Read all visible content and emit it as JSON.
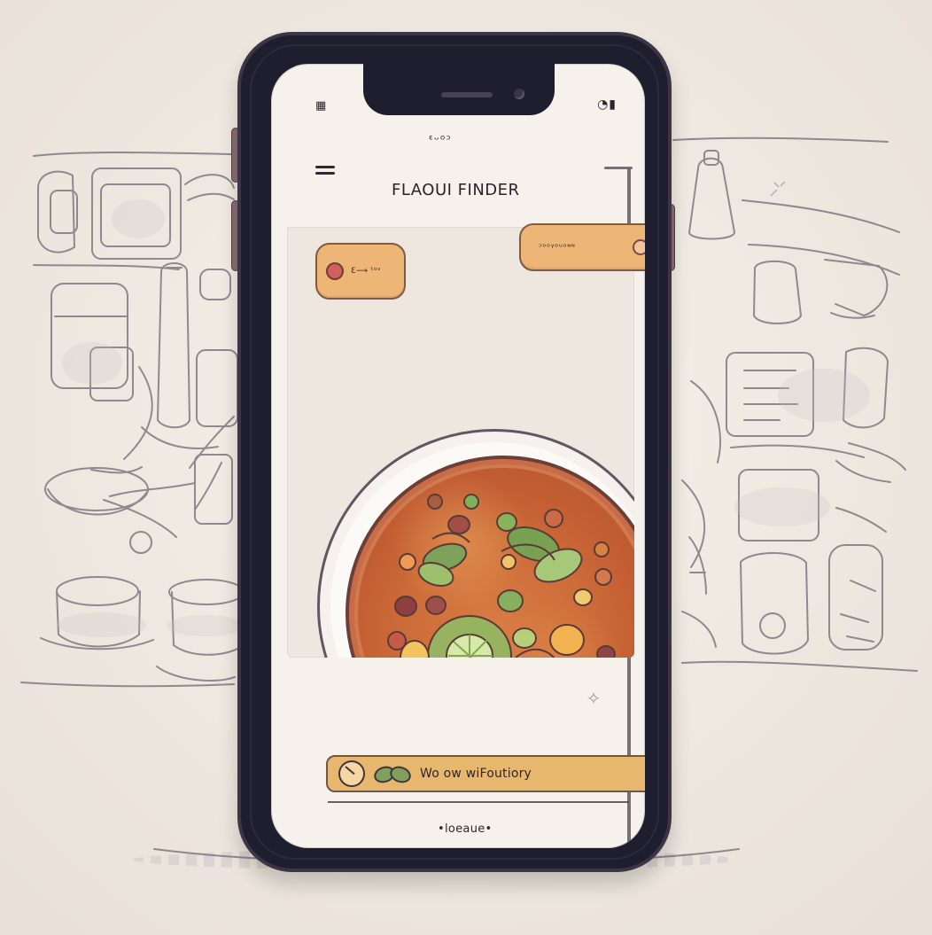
{
  "status": {
    "left": "▦",
    "right": "◔▮"
  },
  "header": {
    "small_brand": "ᵋᵕᵒᵓ",
    "title": "FLAOUI FINDER"
  },
  "chips": {
    "top_left": "Ԑ⟶ ᵗᵒᵛ",
    "top_right": "ᵓᵒᵒᵞᵒᵘᵒᶰᶰ"
  },
  "bottom": {
    "label": "Wo ow wiFoutiory"
  },
  "footer": {
    "text": "•loeaue•"
  },
  "icons": {
    "menu": "menu-icon",
    "play": "play-icon",
    "leaf": "leaf-icon",
    "sparkle": "sparkle-icon"
  },
  "colors": {
    "chip": "#edb576",
    "bar": "#e8b76e",
    "soup": "#cc6c39",
    "phone": "#1f1e2f"
  }
}
